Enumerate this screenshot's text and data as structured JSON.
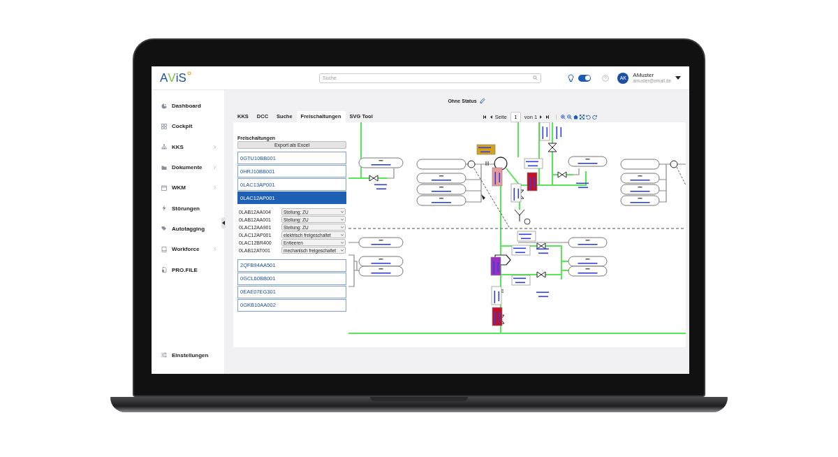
{
  "header": {
    "logo": {
      "first": "A",
      "second": "V",
      "third": "iS"
    },
    "search": {
      "placeholder": "Suche"
    },
    "toggle": {
      "on": true
    },
    "user": {
      "initials": "AK",
      "name": "AMuster",
      "email": "amuster@email.de"
    }
  },
  "sidebar": {
    "items": [
      {
        "label": "Dashboard",
        "submenu": false
      },
      {
        "label": "Cockpit",
        "submenu": false
      },
      {
        "label": "KKS",
        "submenu": true
      },
      {
        "label": "Dokumente",
        "submenu": true
      },
      {
        "label": "WKM",
        "submenu": true
      },
      {
        "label": "Störungen",
        "submenu": false
      },
      {
        "label": "Autotagging",
        "submenu": false
      },
      {
        "label": "Workforce",
        "submenu": true
      },
      {
        "label": "PRO.FILE",
        "submenu": false
      }
    ],
    "footer": {
      "label": "Einstellungen"
    }
  },
  "status": {
    "label": "Ohne Status"
  },
  "tabs": [
    {
      "label": "KKS",
      "selected": false
    },
    {
      "label": "DCC",
      "selected": false
    },
    {
      "label": "Suche",
      "selected": false
    },
    {
      "label": "Freischaltungen",
      "selected": true
    },
    {
      "label": "SVG Tool",
      "selected": false
    }
  ],
  "pager": {
    "page_label": "Seite",
    "page": "1",
    "of_label": "von 1"
  },
  "panel": {
    "title": "Freischaltungen",
    "export_button": "Export als Excel",
    "items": [
      {
        "label": "0GTU10BB001",
        "selected": false
      },
      {
        "label": "0HRJ10BB001",
        "selected": false
      },
      {
        "label": "0LAC13AP001",
        "selected": false
      },
      {
        "label": "0LAC12AP001",
        "selected": true,
        "details": [
          {
            "tag": "0LAB12AA004",
            "state": "Stellung: ZU"
          },
          {
            "tag": "0LAB12AA001",
            "state": "Stellung: ZU"
          },
          {
            "tag": "0LAC12AA901",
            "state": "Stellung: ZU"
          },
          {
            "tag": "0LAC12AP001",
            "state": "elektrisch freigeschaltet"
          },
          {
            "tag": "0LAC12BR400",
            "state": "Entleeren"
          },
          {
            "tag": "0LAB12AT001",
            "state": "mechanisch freigeschaltet"
          }
        ]
      },
      {
        "label": "2QFB94AA501",
        "selected": false
      },
      {
        "label": "0GCL60BB001",
        "selected": false
      },
      {
        "label": "0EAE07EG301",
        "selected": false
      },
      {
        "label": "0GKB10AA002",
        "selected": false
      }
    ]
  }
}
